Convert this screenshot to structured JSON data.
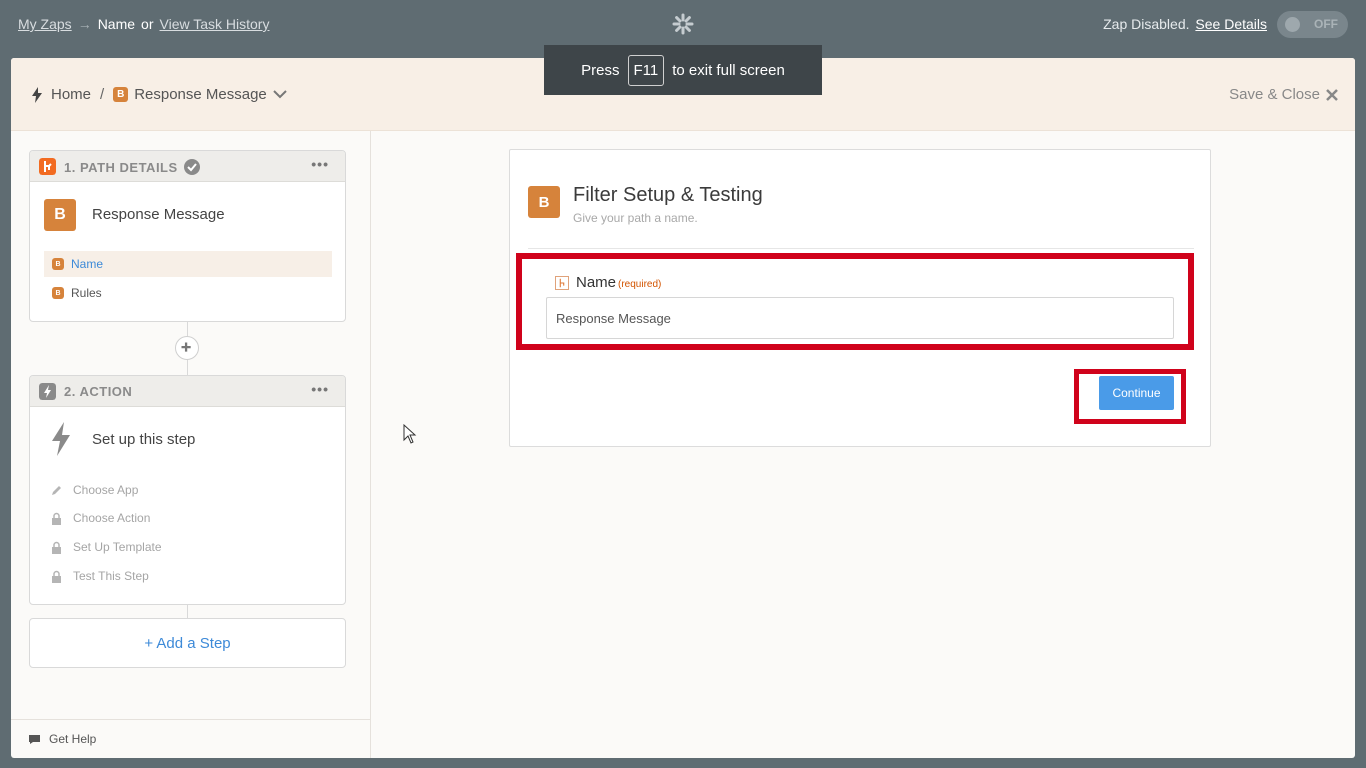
{
  "topbar": {
    "my_zaps": "My Zaps",
    "arrow": "→",
    "current": "Name",
    "or": "or",
    "task_history": "View Task History",
    "status_text": "Zap Disabled.",
    "see_details": "See Details",
    "toggle_label": "OFF"
  },
  "fullscreen_notice": {
    "press": "Press",
    "key": "F11",
    "rest": "to exit full screen"
  },
  "header": {
    "home": "Home",
    "slash": "/",
    "path_badge": "B",
    "path_name": "Response Message",
    "save_close": "Save & Close"
  },
  "steps": [
    {
      "title": "1. PATH DETAILS",
      "badge": "B",
      "name": "Response Message",
      "items": [
        {
          "badge": "B",
          "label": "Name"
        },
        {
          "badge": "B",
          "label": "Rules"
        }
      ]
    },
    {
      "title": "2. ACTION",
      "name": "Set up this step",
      "items": [
        {
          "label": "Choose App"
        },
        {
          "label": "Choose Action"
        },
        {
          "label": "Set Up Template"
        },
        {
          "label": "Test This Step"
        }
      ]
    }
  ],
  "add_step": "+ Add a Step",
  "get_help": "Get Help",
  "main": {
    "badge": "B",
    "title": "Filter Setup & Testing",
    "subtitle": "Give your path a name.",
    "field_label": "Name",
    "field_required": "(required)",
    "field_value": "Response Message",
    "continue": "Continue"
  },
  "colors": {
    "accent_blue": "#4a9be8",
    "path_orange": "#d6833b",
    "highlight_red": "#d0021b"
  }
}
